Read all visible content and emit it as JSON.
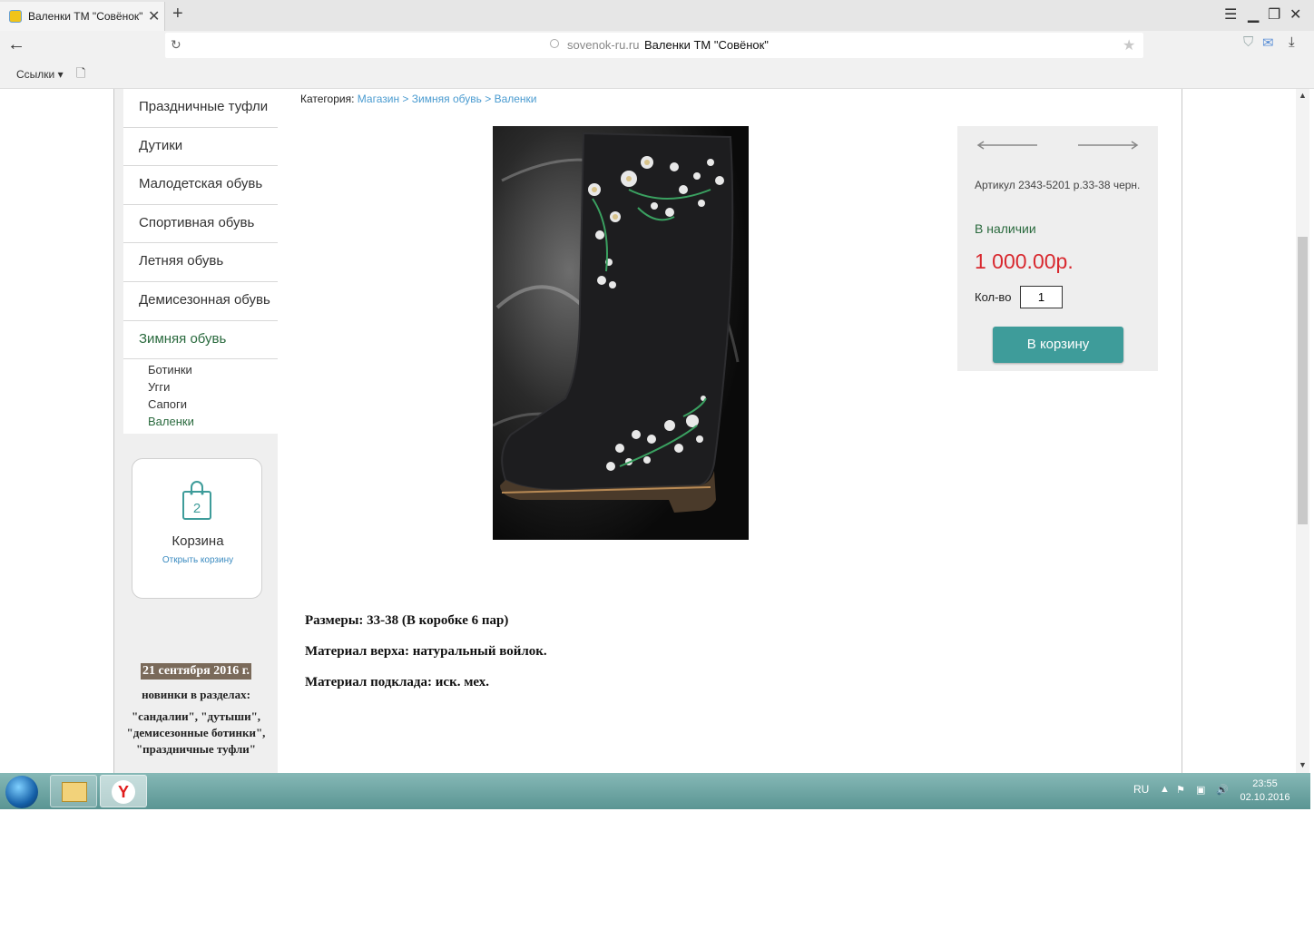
{
  "browser": {
    "tab_title": "Валенки ТМ \"Совёнок\"",
    "tab_close": "✕",
    "new_tab": "+",
    "url_host": "sovenok-ru.ru",
    "page_title": "Валенки ТМ \"Совёнок\"",
    "bookmarks_label": "Ссылки ▾"
  },
  "sidebar": {
    "menu": [
      {
        "label": "Праздничные туфли"
      },
      {
        "label": "Дутики"
      },
      {
        "label": "Малодетская обувь"
      },
      {
        "label": "Спортивная обувь"
      },
      {
        "label": "Летняя обувь"
      },
      {
        "label": "Демисезонная обувь"
      },
      {
        "label": "Зимняя обувь",
        "active": true
      }
    ],
    "submenu": [
      {
        "label": "Ботинки"
      },
      {
        "label": "Угги"
      },
      {
        "label": "Сапоги"
      },
      {
        "label": "Валенки",
        "active": true
      }
    ],
    "cart": {
      "count": "2",
      "label": "Корзина",
      "open_link": "Открыть корзину"
    },
    "news": {
      "date": "21 сентября 2016 г.",
      "line1": "новинки в разделах:",
      "line2": "\"сандалии\", \"дутыши\", \"демисезонные ботинки\", \"праздничные туфли\""
    }
  },
  "breadcrumb": {
    "prefix": "Категория:",
    "items": [
      "Магазин",
      "Зимняя обувь",
      "Валенки"
    ],
    "separator": ">"
  },
  "product": {
    "sku": "Артикул 2343-5201 р.33-38 черн.",
    "stock": "В наличии",
    "price": "1 000.00р.",
    "qty_label": "Кол-во",
    "qty_value": "1",
    "add_to_cart": "В корзину",
    "description": [
      "Размеры: 33-38 (В коробке 6 пар)",
      "Материал верха: натуральный войлок.",
      "Материал подклада: иск. мех."
    ]
  },
  "taskbar": {
    "lang": "RU",
    "time": "23:55",
    "date": "02.10.2016"
  },
  "colors": {
    "accent_green": "#2a6a3e",
    "link_blue": "#4a9bd0",
    "price_red": "#d8282e",
    "button_teal": "#3e9c9a",
    "taskbar": "#6fa6a4"
  }
}
